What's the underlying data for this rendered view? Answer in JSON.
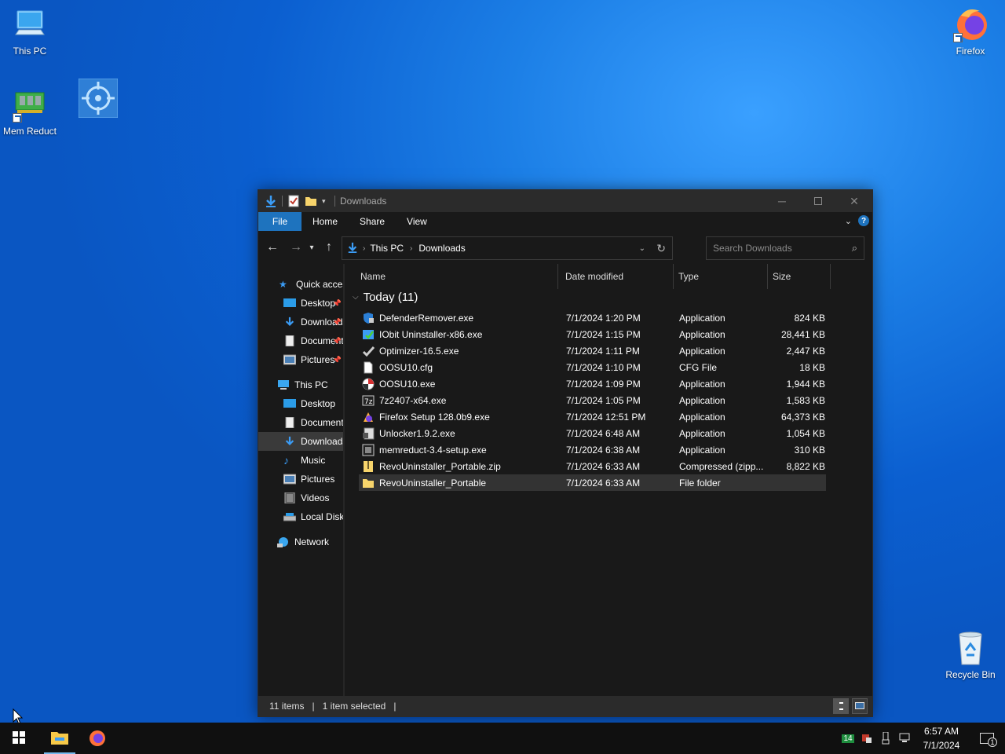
{
  "desktop": {
    "icons": [
      {
        "label": "This PC"
      },
      {
        "label": "Mem Reduct"
      },
      {
        "label": ""
      },
      {
        "label": "Firefox"
      },
      {
        "label": "Recycle Bin"
      }
    ]
  },
  "explorer": {
    "title": "Downloads",
    "ribbon_tabs": [
      "File",
      "Home",
      "Share",
      "View"
    ],
    "breadcrumb": [
      "This PC",
      "Downloads"
    ],
    "search_placeholder": "Search Downloads",
    "nav_items": [
      {
        "label": "Quick access",
        "icon": "star-icon"
      },
      {
        "label": "Desktop",
        "icon": "desktop-folder-icon",
        "pinned": true
      },
      {
        "label": "Downloads",
        "icon": "downloads-folder-icon",
        "pinned": true
      },
      {
        "label": "Documents",
        "icon": "documents-folder-icon",
        "pinned": true
      },
      {
        "label": "Pictures",
        "icon": "pictures-folder-icon",
        "pinned": true
      },
      {
        "label": "This PC",
        "icon": "computer-icon"
      },
      {
        "label": "Desktop",
        "icon": "desktop-folder-icon"
      },
      {
        "label": "Documents",
        "icon": "documents-folder-icon"
      },
      {
        "label": "Downloads",
        "icon": "downloads-folder-icon",
        "selected": true
      },
      {
        "label": "Music",
        "icon": "music-folder-icon"
      },
      {
        "label": "Pictures",
        "icon": "pictures-folder-icon"
      },
      {
        "label": "Videos",
        "icon": "videos-folder-icon"
      },
      {
        "label": "Local Disk",
        "icon": "drive-icon"
      },
      {
        "label": "Network",
        "icon": "network-icon"
      }
    ],
    "columns": [
      "Name",
      "Date modified",
      "Type",
      "Size"
    ],
    "group_label": "Today (11)",
    "files": [
      {
        "name": "DefenderRemover.exe",
        "date": "7/1/2024 1:20 PM",
        "type": "Application",
        "size": "824 KB",
        "icon": "shield-app-icon"
      },
      {
        "name": "IObit Uninstaller-x86.exe",
        "date": "7/1/2024 1:15 PM",
        "type": "Application",
        "size": "28,441 KB",
        "icon": "installer-icon"
      },
      {
        "name": "Optimizer-16.5.exe",
        "date": "7/1/2024 1:11 PM",
        "type": "Application",
        "size": "2,447 KB",
        "icon": "checkmark-app-icon"
      },
      {
        "name": "OOSU10.cfg",
        "date": "7/1/2024 1:10 PM",
        "type": "CFG File",
        "size": "18 KB",
        "icon": "document-icon"
      },
      {
        "name": "OOSU10.exe",
        "date": "7/1/2024 1:09 PM",
        "type": "Application",
        "size": "1,944 KB",
        "icon": "oosu-app-icon"
      },
      {
        "name": "7z2407-x64.exe",
        "date": "7/1/2024 1:05 PM",
        "type": "Application",
        "size": "1,583 KB",
        "icon": "7zip-app-icon"
      },
      {
        "name": "Firefox Setup 128.0b9.exe",
        "date": "7/1/2024 12:51 PM",
        "type": "Application",
        "size": "64,373 KB",
        "icon": "firefox-setup-icon"
      },
      {
        "name": "Unlocker1.9.2.exe",
        "date": "7/1/2024 6:48 AM",
        "type": "Application",
        "size": "1,054 KB",
        "icon": "unlocker-app-icon"
      },
      {
        "name": "memreduct-3.4-setup.exe",
        "date": "7/1/2024 6:38 AM",
        "type": "Application",
        "size": "310 KB",
        "icon": "memreduct-app-icon"
      },
      {
        "name": "RevoUninstaller_Portable.zip",
        "date": "7/1/2024 6:33 AM",
        "type": "Compressed (zipp...",
        "size": "8,822 KB",
        "icon": "zip-folder-icon"
      },
      {
        "name": "RevoUninstaller_Portable",
        "date": "7/1/2024 6:33 AM",
        "type": "File folder",
        "size": "",
        "icon": "folder-icon",
        "selected": true
      }
    ],
    "status": {
      "items": "11 items",
      "selected": "1 item selected"
    }
  },
  "taskbar": {
    "time": "6:57 AM",
    "date": "7/1/2024",
    "tray_badge": "14",
    "notification_count": "1"
  },
  "colors": {
    "accent": "#1e73be",
    "window_bg": "#191919",
    "titlebar_bg": "#2b2b2b",
    "taskbar_bg": "#101010"
  }
}
